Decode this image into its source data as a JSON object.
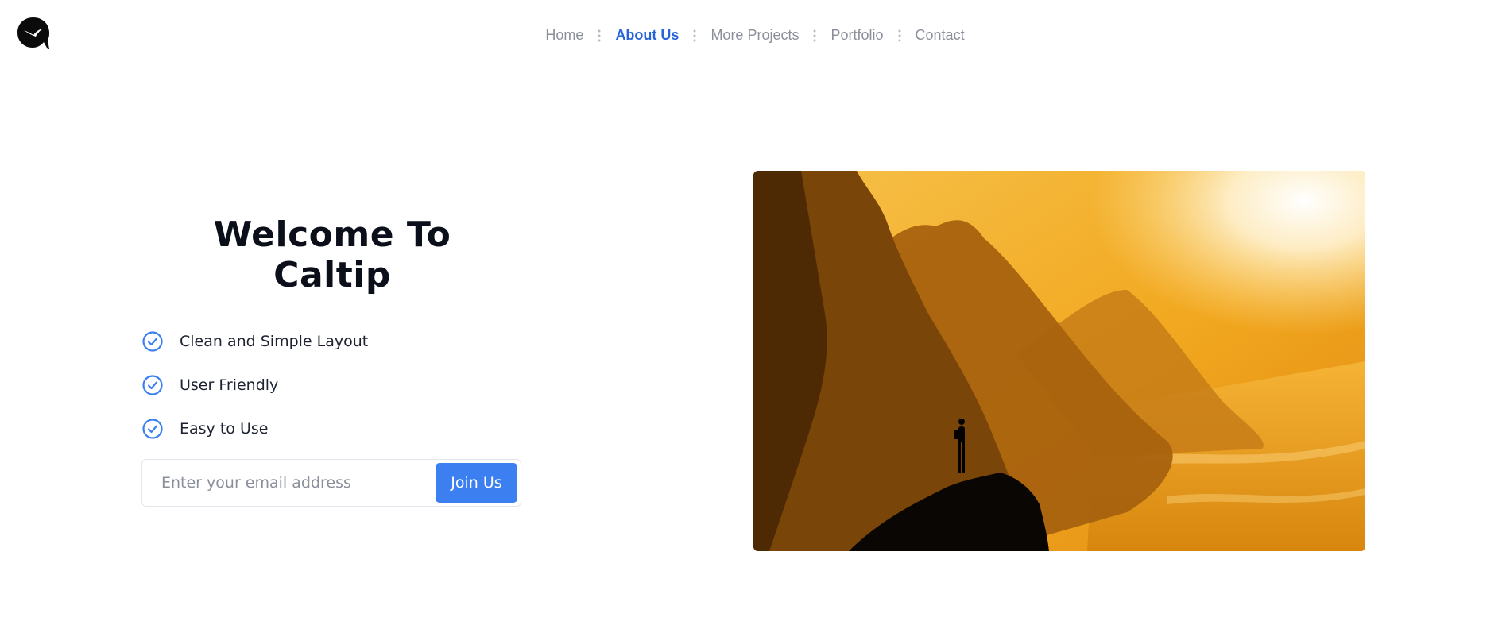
{
  "brand": {
    "logo_icon": "swallow-leaf-logo-icon"
  },
  "nav": {
    "items": [
      {
        "label": "Home",
        "active": false
      },
      {
        "label": "About Us",
        "active": true
      },
      {
        "label": "More Projects",
        "active": false
      },
      {
        "label": "Portfolio",
        "active": false
      },
      {
        "label": "Contact",
        "active": false
      }
    ],
    "separator_icon": "vertical-dots-icon",
    "active_color": "#2864d9",
    "inactive_color": "#8b8f9b"
  },
  "hero": {
    "title": "Welcome To Caltip",
    "features": [
      {
        "label": "Clean and Simple Layout",
        "icon": "check-circle-icon"
      },
      {
        "label": "User Friendly",
        "icon": "check-circle-icon"
      },
      {
        "label": "Easy to Use",
        "icon": "check-circle-icon"
      }
    ],
    "email": {
      "placeholder": "Enter your email address",
      "value": ""
    },
    "join_label": "Join Us",
    "accent_color": "#3b7ff0",
    "image_alt": "hiker-silhouette-sunset-cliffs-image"
  }
}
